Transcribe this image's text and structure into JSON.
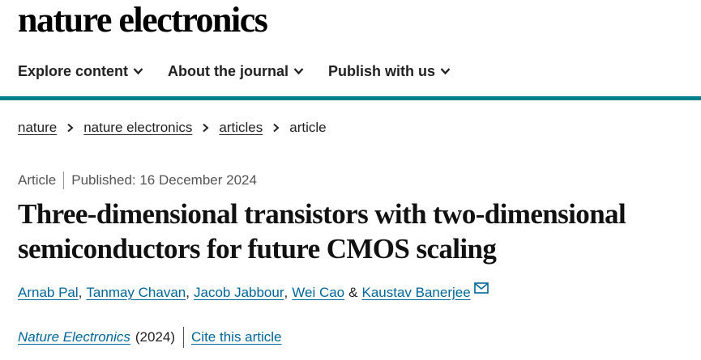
{
  "site": {
    "logo_text": "nature electronics"
  },
  "nav": {
    "items": [
      {
        "label": "Explore content"
      },
      {
        "label": "About the journal"
      },
      {
        "label": "Publish with us"
      }
    ]
  },
  "colors": {
    "accent": "#00818a",
    "link": "#006699"
  },
  "breadcrumb": {
    "items": [
      {
        "label": "nature"
      },
      {
        "label": "nature electronics"
      },
      {
        "label": "articles"
      }
    ],
    "current": "article"
  },
  "article": {
    "type": "Article",
    "published": "Published: 16 December 2024",
    "title_line1": "Three-dimensional transistors with two-dimensional",
    "title_line2": "semiconductors for future CMOS scaling",
    "authors": [
      {
        "name": "Arnab Pal",
        "sep": ","
      },
      {
        "name": "Tanmay Chavan",
        "sep": ","
      },
      {
        "name": "Jacob Jabbour",
        "sep": ","
      },
      {
        "name": "Wei Cao",
        "sep": "&"
      },
      {
        "name": "Kaustav Banerjee",
        "sep": ""
      }
    ],
    "journal": "Nature Electronics",
    "year": "(2024)",
    "cite_label": "Cite this article"
  },
  "icons": {
    "nav_chevron": "chevron-down-icon",
    "breadcrumb_sep": "chevron-right-icon",
    "email": "envelope-icon"
  }
}
